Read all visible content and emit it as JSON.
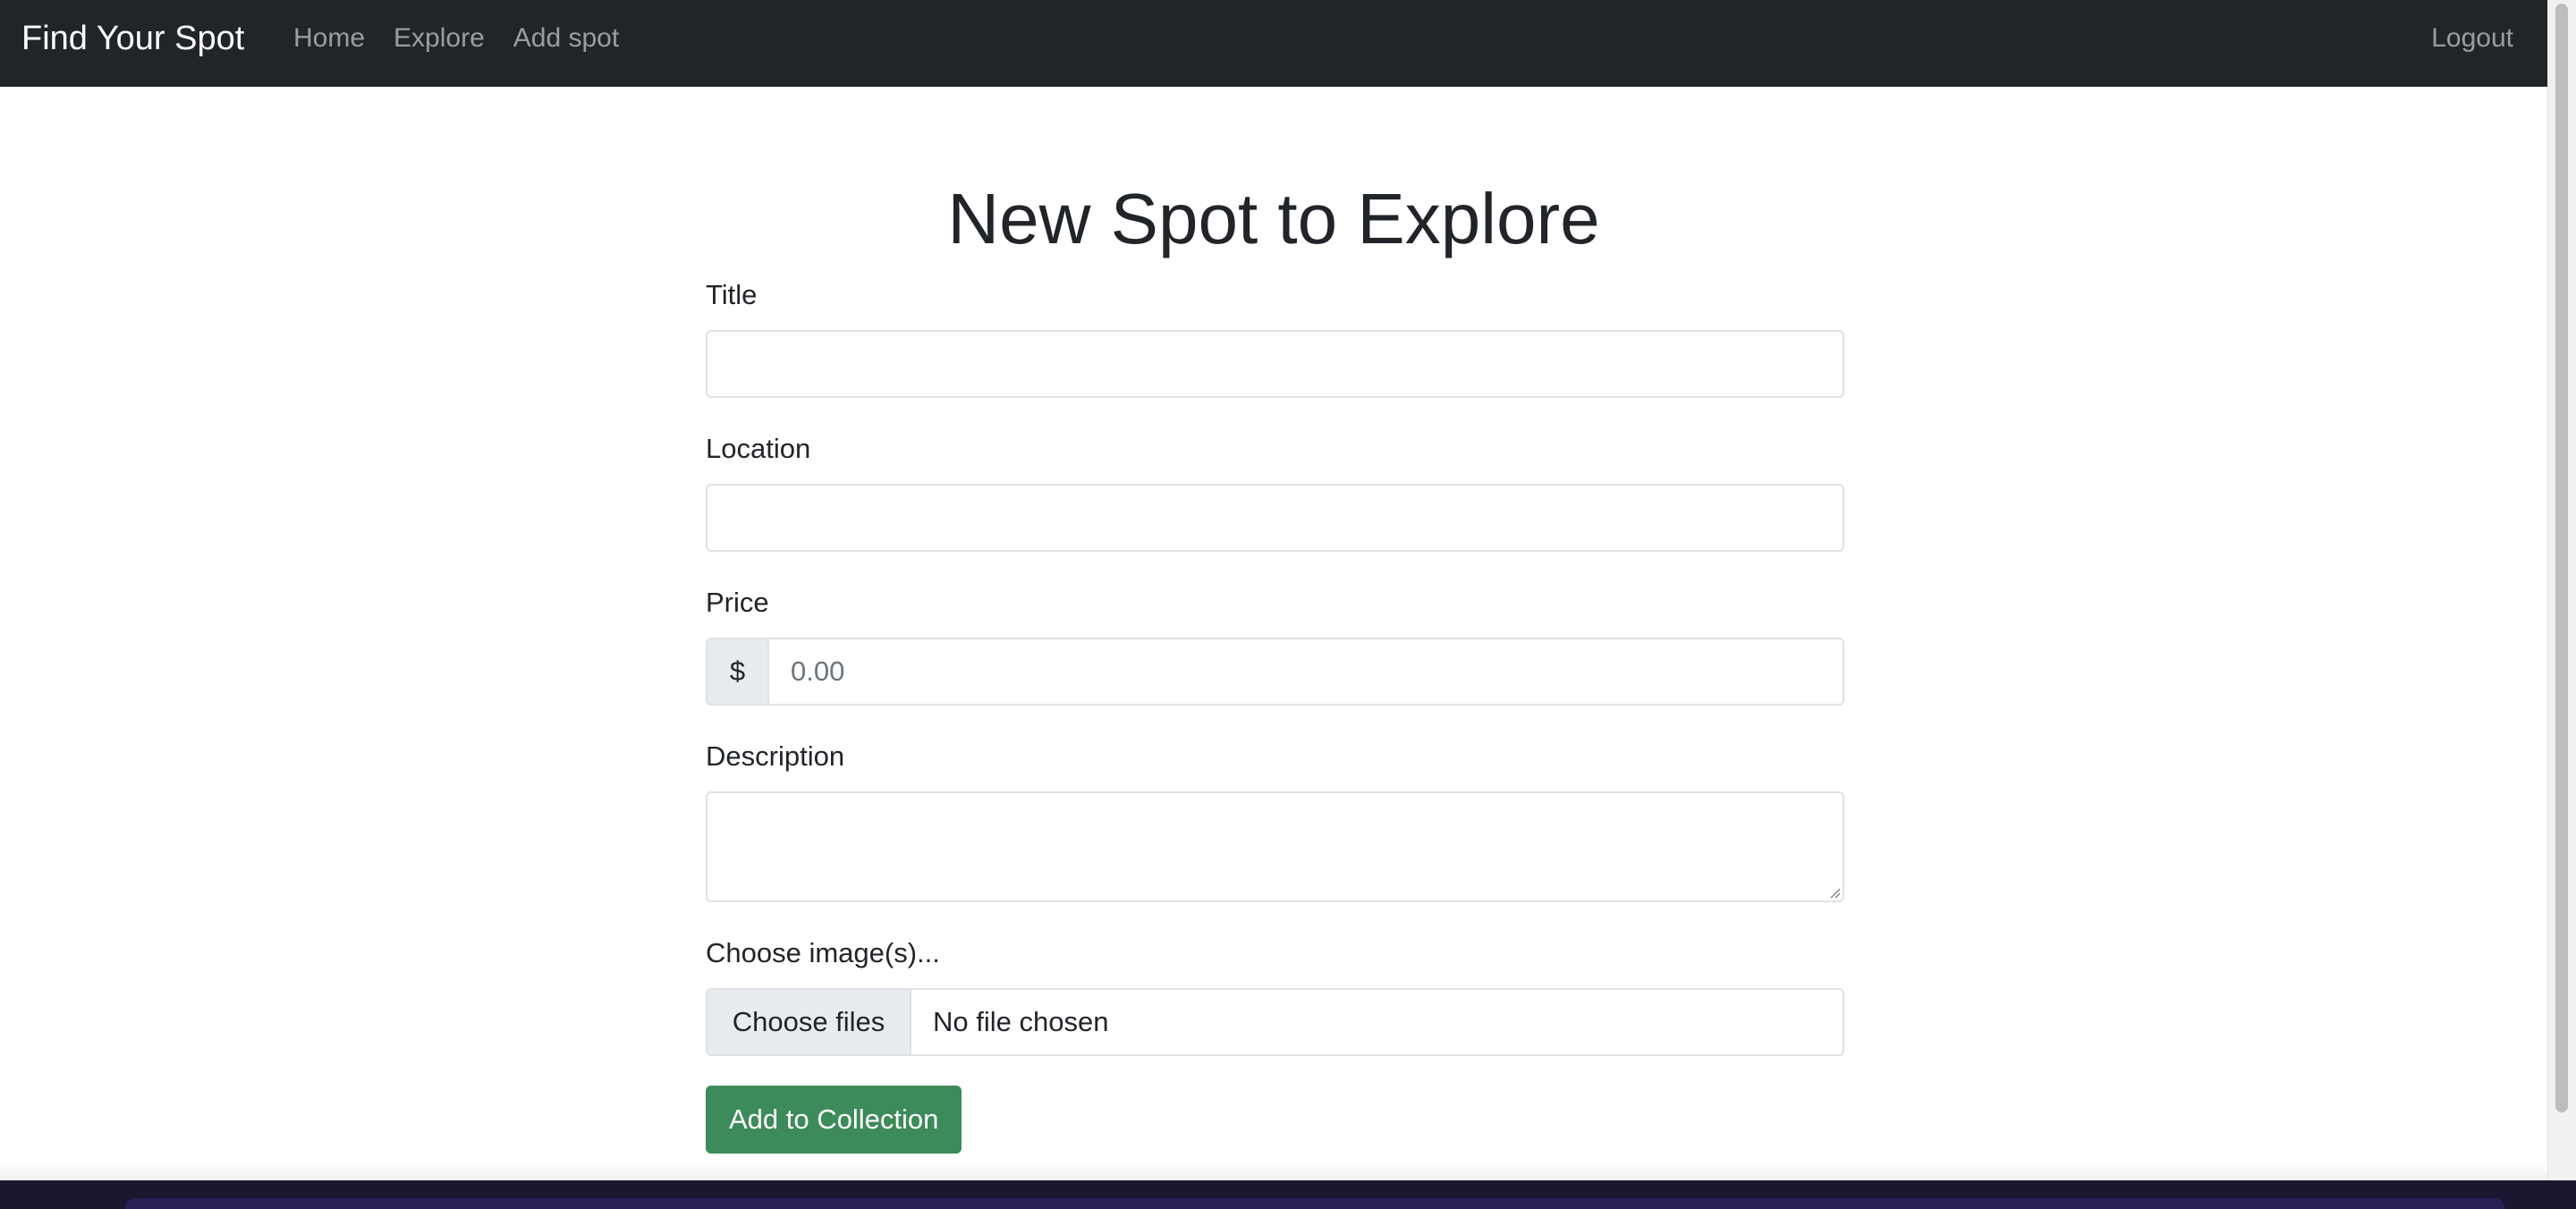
{
  "navbar": {
    "brand": "Find Your Spot",
    "links": [
      "Home",
      "Explore",
      "Add spot"
    ],
    "logout": "Logout"
  },
  "page": {
    "title": "New Spot to Explore"
  },
  "form": {
    "title_label": "Title",
    "title_value": "",
    "location_label": "Location",
    "location_value": "",
    "price_label": "Price",
    "price_currency": "$",
    "price_placeholder": "0.00",
    "description_label": "Description",
    "description_value": "",
    "images_label": "Choose image(s)...",
    "file_button": "Choose files",
    "file_status": "No file chosen",
    "submit_label": "Add to Collection"
  },
  "colors": {
    "navbar_bg": "#212529",
    "submit_bg": "#3d8a5a",
    "text": "#212529"
  }
}
